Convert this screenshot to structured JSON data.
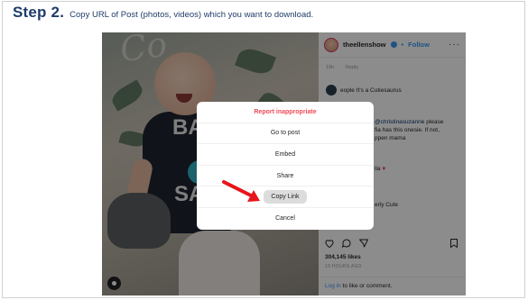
{
  "step": {
    "title": "Step 2.",
    "description": "Copy URL of Post (photos, videos) which you want to download."
  },
  "photo": {
    "background_text": "Co",
    "onesie_letters": [
      "BA",
      "SA"
    ]
  },
  "panel": {
    "username": "theellenshow",
    "separator": "•",
    "follow_label": "Follow",
    "more_label": "···",
    "comments": [
      {
        "text": "19h",
        "reply": "Reply"
      },
      {
        "text": "eople",
        "highlight": " It's a Cutiesaurus"
      },
      {
        "mention": "@christinasuzanne",
        "text": " please"
      },
      {
        "text": "fia has this onesie. If not,"
      },
      {
        "text": "ppen mama"
      },
      {
        "text": "lla"
      },
      {
        "text": "erly Cute"
      }
    ],
    "likes": "304,145 likes",
    "time_ago": "19 HOURS AGO",
    "login_link": "Log in",
    "login_text": " to like or comment."
  },
  "modal": {
    "items": [
      {
        "label": "Report inappropriate",
        "style": "danger"
      },
      {
        "label": "Go to post"
      },
      {
        "label": "Embed"
      },
      {
        "label": "Share"
      },
      {
        "label": "Copy Link",
        "style": "highlight"
      },
      {
        "label": "Cancel"
      }
    ]
  },
  "colors": {
    "step_text": "#1f3c6b",
    "danger": "#ed4956",
    "link": "#3897f0",
    "arrow": "#e8151b"
  }
}
